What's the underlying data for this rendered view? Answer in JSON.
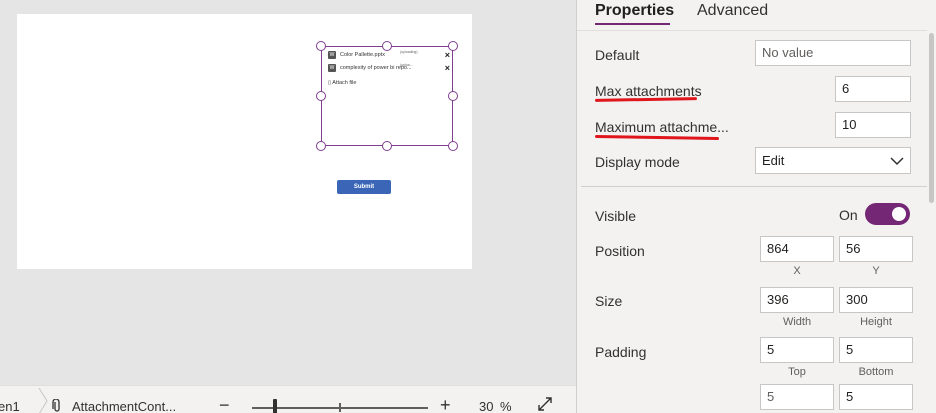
{
  "canvas": {
    "attachments": [
      {
        "name": "Color Pallette.pptx",
        "size": "(uploading)"
      },
      {
        "name": "complexity of power bi repo...",
        "size": "(uploa..."
      }
    ],
    "attach_link": "Attach file",
    "remove_icon": "×",
    "file_icon": "W",
    "submit_label": "Submit"
  },
  "bottom_bar": {
    "screen_crumb": "en1",
    "control_crumb": "AttachmentCont...",
    "zoom_minus": "−",
    "zoom_plus": "+",
    "zoom_value": "30",
    "zoom_unit": "%",
    "zoom_level_fraction": 0.12,
    "fit_icon": "⤢",
    "clip_icon": "📎"
  },
  "panel": {
    "tabs": [
      {
        "label": "Properties",
        "active": true
      },
      {
        "label": "Advanced",
        "active": false
      }
    ],
    "accent_color": "#742774",
    "annotation_color": "#e0161c",
    "default": {
      "label": "Default",
      "placeholder": "No value"
    },
    "max_attachments": {
      "label": "Max attachments",
      "value": "6"
    },
    "maximum_attachment_size": {
      "label": "Maximum attachme...",
      "value": "10"
    },
    "display_mode": {
      "label": "Display mode",
      "value": "Edit"
    },
    "visible": {
      "label": "Visible",
      "state": "On"
    },
    "position": {
      "label": "Position",
      "x": "864",
      "y": "56",
      "x_caption": "X",
      "y_caption": "Y"
    },
    "size": {
      "label": "Size",
      "width": "396",
      "height": "300",
      "width_caption": "Width",
      "height_caption": "Height"
    },
    "padding": {
      "label": "Padding",
      "values": [
        "5",
        "5",
        "5",
        "5"
      ],
      "top_caption": "Top",
      "bottom_caption": "Bottom"
    }
  }
}
